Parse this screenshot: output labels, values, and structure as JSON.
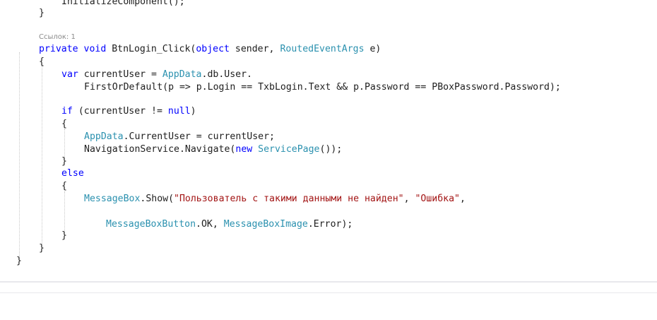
{
  "editor": {
    "codelens": "Ссылок: 1",
    "lines": {
      "l0": {
        "a": "InitializeComponent();"
      },
      "l1": {
        "a": "}"
      },
      "l2": {
        "k1": "private",
        "sp1": " ",
        "k2": "void",
        "b": " BtnLogin_Click(",
        "k3": "object",
        "c": " sender, ",
        "t1": "RoutedEventArgs",
        "d": " e)"
      },
      "l3": {
        "a": "{"
      },
      "l4": {
        "k1": "var",
        "a": " currentUser = ",
        "t1": "AppData",
        "b": ".db.User."
      },
      "l5": {
        "a": "FirstOrDefault(p => p.Login == TxbLogin.Text && p.Password == PBoxPassword.Password);"
      },
      "l6": {
        "k1": "if",
        "a": " (currentUser != ",
        "k2": "null",
        "b": ")"
      },
      "l7": {
        "a": "{"
      },
      "l8": {
        "t1": "AppData",
        "a": ".CurrentUser = currentUser;"
      },
      "l9": {
        "a": "NavigationService.Navigate(",
        "k1": "new",
        "sp1": " ",
        "t1": "ServicePage",
        "b": "());"
      },
      "l10": {
        "a": "}"
      },
      "l11": {
        "k1": "else"
      },
      "l12": {
        "a": "{"
      },
      "l13": {
        "t1": "MessageBox",
        "a": ".Show(",
        "s1": "\"Пользователь с такими данными не найден\"",
        "b": ", ",
        "s2": "\"Ошибка\"",
        "c": ","
      },
      "l14": {
        "t1": "MessageBoxButton",
        "a": ".OK, ",
        "t2": "MessageBoxImage",
        "b": ".Error);"
      },
      "l15": {
        "a": "}"
      },
      "l16": {
        "a": "}"
      },
      "l17": {
        "a": "}"
      }
    }
  }
}
